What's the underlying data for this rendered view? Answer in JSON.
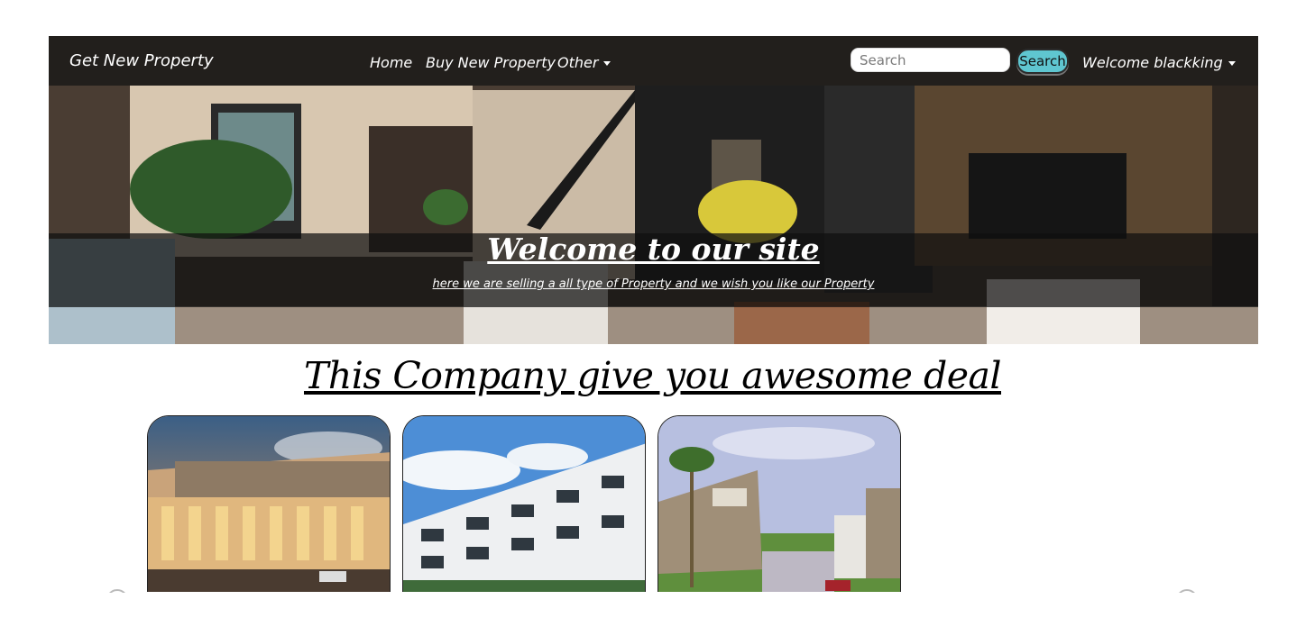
{
  "navbar": {
    "brand": "Get New Property",
    "links": [
      "Home",
      "Buy New Property",
      "Other"
    ],
    "search": {
      "placeholder": "Search",
      "button_label": "Search"
    },
    "user_menu": "Welcome blackking"
  },
  "hero": {
    "title": "Welcome to our site",
    "subtitle": "here we are selling a all type of Property and we wish you like our Property"
  },
  "main": {
    "headline": "This Company give you awesome deal",
    "cards": [
      {
        "image": "shopping-mall-photo"
      },
      {
        "image": "apartment-building-photo"
      },
      {
        "image": "gated-community-photo"
      }
    ]
  },
  "colors": {
    "navbar_bg": "#141414",
    "search_button": "#5fc6d0",
    "text_light": "#ffffff"
  }
}
